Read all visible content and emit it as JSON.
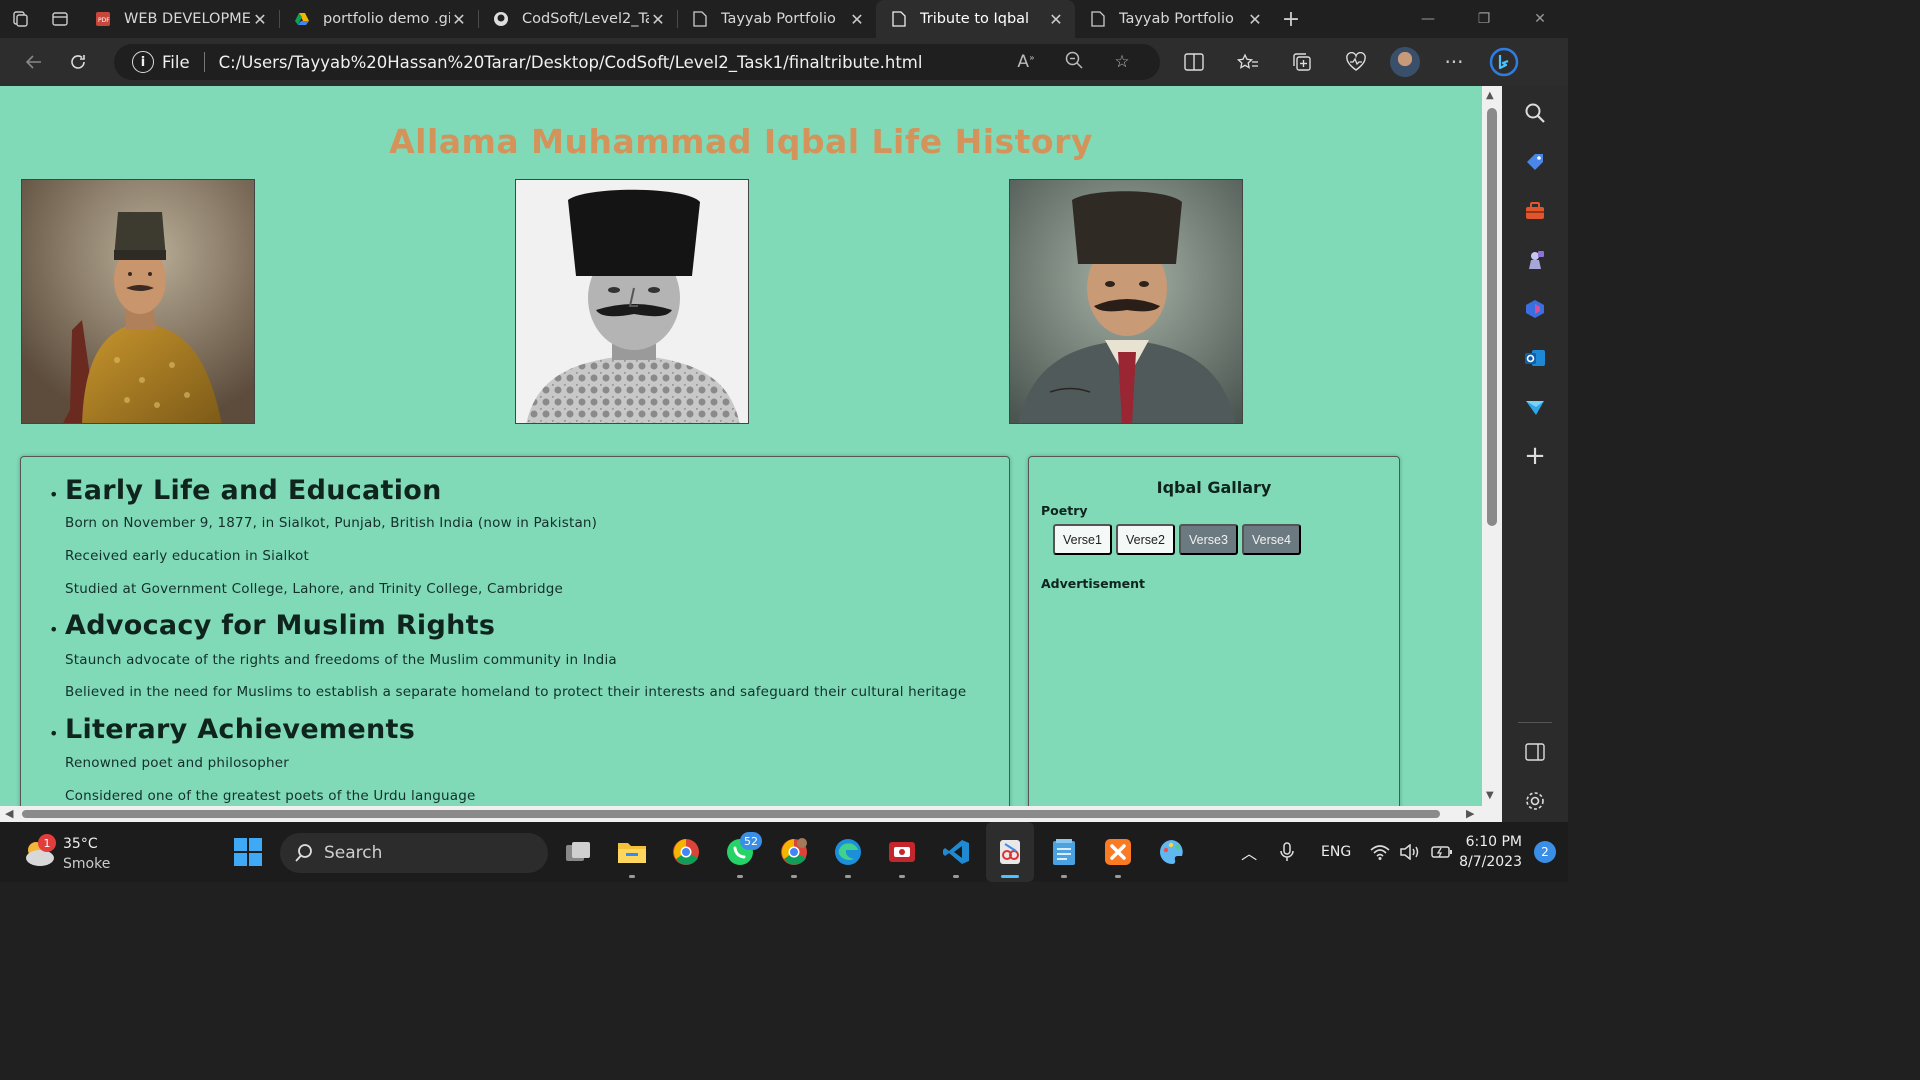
{
  "browser": {
    "tabs": [
      {
        "title": "WEB DEVELOPMENT",
        "favicon": "pdf-icon",
        "active": false
      },
      {
        "title": "portfolio demo .gif",
        "favicon": "drive-icon",
        "active": false
      },
      {
        "title": "CodSoft/Level2_Task1",
        "favicon": "github-icon",
        "active": false
      },
      {
        "title": "Tayyab Portfolio",
        "favicon": "page-icon",
        "active": false
      },
      {
        "title": "Tribute to Iqbal",
        "favicon": "page-icon",
        "active": true
      },
      {
        "title": "Tayyab Portfolio",
        "favicon": "page-icon",
        "active": false
      }
    ],
    "address": {
      "scheme_label": "File",
      "url": "C:/Users/Tayyab%20Hassan%20Tarar/Desktop/CodSoft/Level2_Task1/finaltribute.html"
    }
  },
  "page": {
    "title": "Allama Muhammad Iqbal Life History",
    "sections": [
      {
        "heading": "Early Life and Education",
        "lines": [
          "Born on November 9, 1877, in Sialkot, Punjab, British India (now in Pakistan)",
          "Received early education in Sialkot",
          "Studied at Government College, Lahore, and Trinity College, Cambridge"
        ]
      },
      {
        "heading": "Advocacy for Muslim Rights",
        "lines": [
          "Staunch advocate of the rights and freedoms of the Muslim community in India",
          "Believed in the need for Muslims to establish a separate homeland to protect their interests and safeguard their cultural heritage"
        ]
      },
      {
        "heading": "Literary Achievements",
        "lines": [
          "Renowned poet and philosopher",
          "Considered one of the greatest poets of the Urdu language"
        ]
      }
    ],
    "gallery": {
      "title": "Iqbal Gallary",
      "poetry_label": "Poetry",
      "verses": [
        "Verse1",
        "Verse2",
        "Verse3",
        "Verse4"
      ],
      "advertisement_label": "Advertisement"
    },
    "colors": {
      "background": "#80dab8",
      "title": "#d4935a",
      "verse_light": "#f4f8f6",
      "verse_dark": "#6b7a80"
    }
  },
  "taskbar": {
    "weather": {
      "temp": "35°C",
      "condition": "Smoke",
      "badge": "1"
    },
    "search_label": "Search",
    "whatsapp_badge": "52",
    "tray": {
      "language": "ENG",
      "time": "6:10 PM",
      "date": "8/7/2023",
      "notifications": "2"
    }
  }
}
